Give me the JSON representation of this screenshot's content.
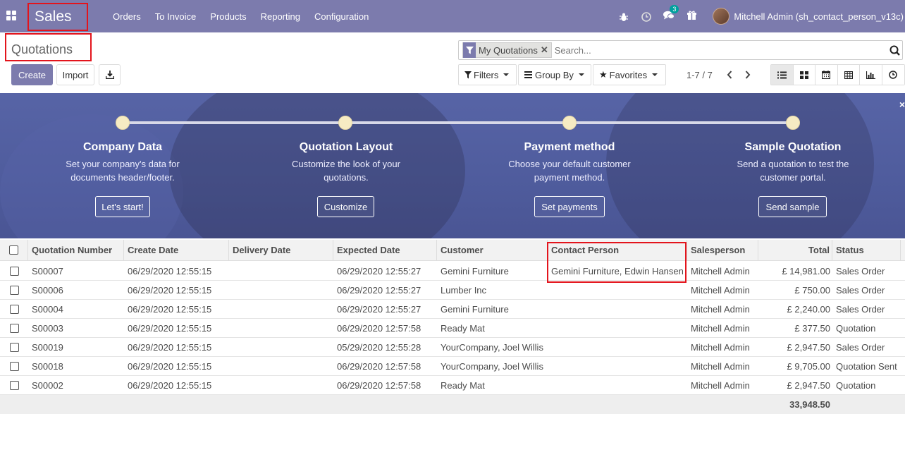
{
  "navbar": {
    "brand": "Sales",
    "menu": [
      "Orders",
      "To Invoice",
      "Products",
      "Reporting",
      "Configuration"
    ],
    "chat_count": "3",
    "user": "Mitchell Admin (sh_contact_person_v13c)"
  },
  "control": {
    "breadcrumb": "Quotations",
    "create_label": "Create",
    "import_label": "Import",
    "facet": "My Quotations",
    "search_placeholder": "Search...",
    "filters_label": "Filters",
    "groupby_label": "Group By",
    "favorites_label": "Favorites",
    "pager": "1-7 / 7"
  },
  "banner": {
    "steps": [
      {
        "title": "Company Data",
        "desc": "Set your company's data for documents header/footer.",
        "button": "Let's start!"
      },
      {
        "title": "Quotation Layout",
        "desc": "Customize the look of your quotations.",
        "button": "Customize"
      },
      {
        "title": "Payment method",
        "desc": "Choose your default customer payment method.",
        "button": "Set payments"
      },
      {
        "title": "Sample Quotation",
        "desc": "Send a quotation to test the customer portal.",
        "button": "Send sample"
      }
    ],
    "close": "×"
  },
  "table": {
    "headers": [
      "Quotation Number",
      "Create Date",
      "Delivery Date",
      "Expected Date",
      "Customer",
      "Contact Person",
      "Salesperson",
      "Total",
      "Status"
    ],
    "rows": [
      [
        "S00007",
        "06/29/2020 12:55:15",
        "",
        "06/29/2020 12:55:27",
        "Gemini Furniture",
        "Gemini Furniture, Edwin Hansen",
        "Mitchell Admin",
        "£ 14,981.00",
        "Sales Order"
      ],
      [
        "S00006",
        "06/29/2020 12:55:15",
        "",
        "06/29/2020 12:55:27",
        "Lumber Inc",
        "",
        "Mitchell Admin",
        "£ 750.00",
        "Sales Order"
      ],
      [
        "S00004",
        "06/29/2020 12:55:15",
        "",
        "06/29/2020 12:55:27",
        "Gemini Furniture",
        "",
        "Mitchell Admin",
        "£ 2,240.00",
        "Sales Order"
      ],
      [
        "S00003",
        "06/29/2020 12:55:15",
        "",
        "06/29/2020 12:57:58",
        "Ready Mat",
        "",
        "Mitchell Admin",
        "£ 377.50",
        "Quotation"
      ],
      [
        "S00019",
        "06/29/2020 12:55:15",
        "",
        "05/29/2020 12:55:28",
        "YourCompany, Joel Willis",
        "",
        "Mitchell Admin",
        "£ 2,947.50",
        "Sales Order"
      ],
      [
        "S00018",
        "06/29/2020 12:55:15",
        "",
        "06/29/2020 12:57:58",
        "YourCompany, Joel Willis",
        "",
        "Mitchell Admin",
        "£ 9,705.00",
        "Quotation Sent"
      ],
      [
        "S00002",
        "06/29/2020 12:55:15",
        "",
        "06/29/2020 12:57:58",
        "Ready Mat",
        "",
        "Mitchell Admin",
        "£ 2,947.50",
        "Quotation"
      ]
    ],
    "total": "33,948.50"
  },
  "colors": {
    "brand": "#7c7bad",
    "highlight": "#e3141c",
    "banner": "#5764a6"
  }
}
